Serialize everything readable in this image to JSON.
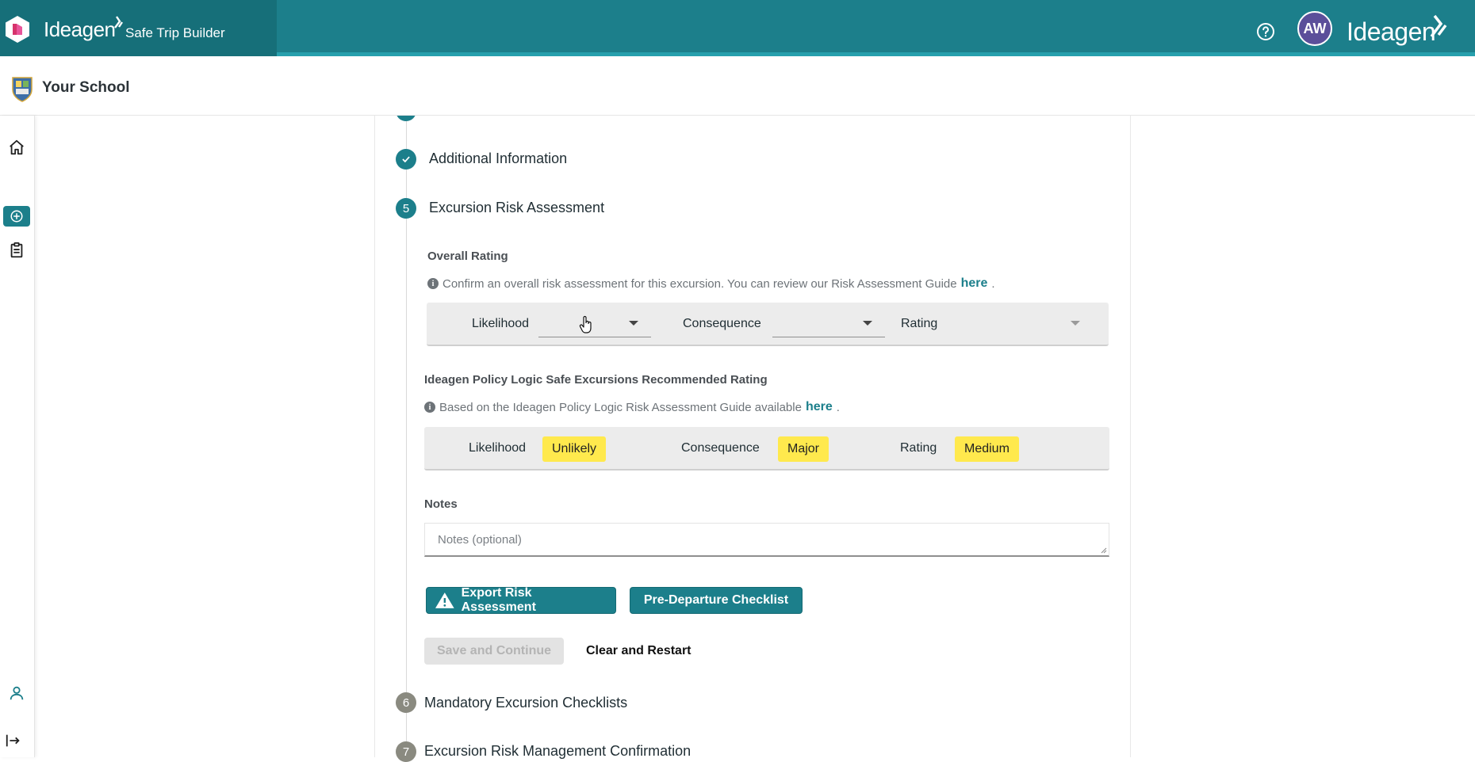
{
  "header": {
    "brand": "Ideagen",
    "app_name": "Safe Trip Builder",
    "avatar_initials": "AW",
    "right_logo": "Ideagen"
  },
  "school": {
    "name": "Your School"
  },
  "steps": {
    "additional_info": "Additional Information",
    "risk_number": "5",
    "risk_label": "Excursion Risk Assessment",
    "mandatory_number": "6",
    "mandatory_label": "Mandatory Excursion Checklists",
    "confirmation_number": "7",
    "confirmation_label": "Excursion Risk Management Confirmation"
  },
  "overall": {
    "heading": "Overall Rating",
    "info_text": "Confirm an overall risk assessment for this excursion. You can review our Risk Assessment Guide",
    "info_link": "here",
    "likelihood_label": "Likelihood",
    "consequence_label": "Consequence",
    "rating_label": "Rating"
  },
  "recommended": {
    "heading": "Ideagen Policy Logic Safe Excursions Recommended Rating",
    "info_text": "Based on the Ideagen Policy Logic Risk Assessment Guide available",
    "info_link": "here",
    "likelihood_label": "Likelihood",
    "likelihood_value": "Unlikely",
    "consequence_label": "Consequence",
    "consequence_value": "Major",
    "rating_label": "Rating",
    "rating_value": "Medium"
  },
  "notes": {
    "heading": "Notes",
    "placeholder": "Notes (optional)"
  },
  "actions": {
    "export_label": "Export Risk Assessment",
    "checklist_label": "Pre-Departure Checklist",
    "save_label": "Save and Continue",
    "clear_label": "Clear and Restart"
  },
  "colors": {
    "teal": "#1c7f8b",
    "teal_dark": "#166f79",
    "highlight": "#ffe94d",
    "avatar": "#5b4f9a"
  }
}
